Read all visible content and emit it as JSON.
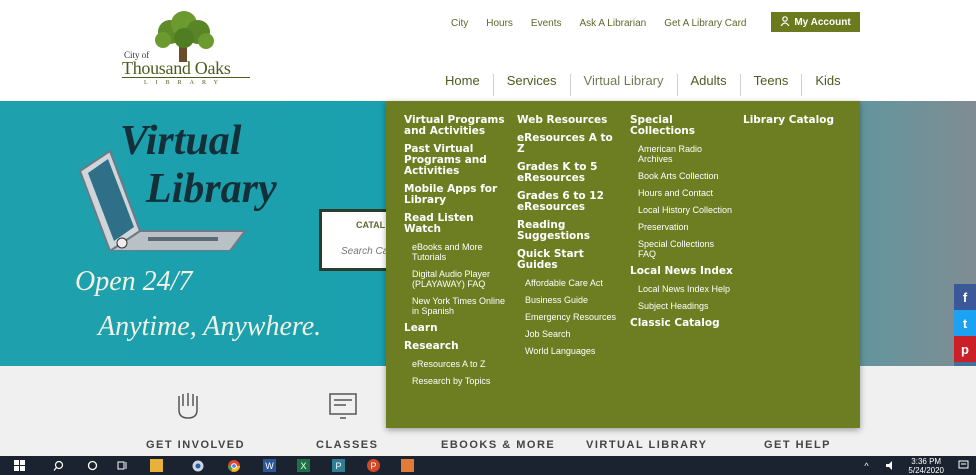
{
  "logo": {
    "city_of": "City of",
    "name": "Thousand Oaks",
    "library": "LIBRARY"
  },
  "utility_nav": [
    "City",
    "Hours",
    "Events",
    "Ask A Librarian",
    "Get A Library Card"
  ],
  "account_button": "My Account",
  "main_nav": [
    "Home",
    "Services",
    "Virtual Library",
    "Adults",
    "Teens",
    "Kids"
  ],
  "hero": {
    "line1": "Virtual",
    "line2": "Library",
    "line3": "Open 24/7",
    "line4": "Anytime, Anywhere.",
    "catalog_label": "CATAL",
    "search_placeholder": "Search Cat"
  },
  "dropdown": {
    "col1": [
      {
        "t": "h",
        "text": "Virtual Programs and Activities"
      },
      {
        "t": "h",
        "text": "Past Virtual Programs and Activities"
      },
      {
        "t": "h",
        "text": "Mobile Apps for Library"
      },
      {
        "t": "h",
        "text": "Read Listen Watch"
      },
      {
        "t": "s",
        "text": "eBooks and More Tutorials"
      },
      {
        "t": "s",
        "text": "Digital Audio Player (PLAYAWAY) FAQ"
      },
      {
        "t": "s",
        "text": "New York Times Online in Spanish"
      },
      {
        "t": "h",
        "text": "Learn"
      },
      {
        "t": "h",
        "text": "Research"
      },
      {
        "t": "s",
        "text": "eResources A to Z"
      },
      {
        "t": "s",
        "text": "Research by Topics"
      }
    ],
    "col2": [
      {
        "t": "h",
        "text": "Web Resources"
      },
      {
        "t": "h",
        "text": "eResources A to Z"
      },
      {
        "t": "h",
        "text": "Grades K to 5 eResources"
      },
      {
        "t": "h",
        "text": "Grades 6 to 12 eResources"
      },
      {
        "t": "h",
        "text": "Reading Suggestions"
      },
      {
        "t": "h",
        "text": "Quick Start Guides"
      },
      {
        "t": "s",
        "text": "Affordable Care Act"
      },
      {
        "t": "s",
        "text": "Business Guide"
      },
      {
        "t": "s",
        "text": "Emergency Resources"
      },
      {
        "t": "s",
        "text": "Job Search"
      },
      {
        "t": "s",
        "text": "World Languages"
      }
    ],
    "col3": [
      {
        "t": "h",
        "text": "Special Collections"
      },
      {
        "t": "s",
        "text": "American Radio Archives"
      },
      {
        "t": "s",
        "text": "Book Arts Collection"
      },
      {
        "t": "s",
        "text": "Hours and Contact"
      },
      {
        "t": "s",
        "text": "Local History Collection"
      },
      {
        "t": "s",
        "text": "Preservation"
      },
      {
        "t": "s",
        "text": "Special Collections FAQ"
      },
      {
        "t": "h",
        "text": "Local News Index"
      },
      {
        "t": "s",
        "text": "Local News Index Help"
      },
      {
        "t": "s",
        "text": "Subject Headings"
      },
      {
        "t": "h",
        "text": "Classic Catalog"
      }
    ],
    "col4": [
      {
        "t": "h",
        "text": "Library Catalog"
      }
    ]
  },
  "quick_links": [
    "GET INVOLVED",
    "CLASSES",
    "EBOOKS & MORE",
    "VIRTUAL LIBRARY",
    "GET HELP"
  ],
  "social": [
    {
      "icon": "facebook-icon",
      "glyph": "f",
      "color": "#3b5998"
    },
    {
      "icon": "twitter-icon",
      "glyph": "t",
      "color": "#1da1f2"
    },
    {
      "icon": "pinterest-icon",
      "glyph": "p",
      "color": "#cb2027"
    },
    {
      "icon": "instagram-icon",
      "glyph": "◎",
      "color": "#3f729b"
    },
    {
      "icon": "youtube-icon",
      "glyph": "▶",
      "color": "#cd201f"
    }
  ],
  "taskbar": {
    "time": "3:36 PM",
    "date": "5/24/2020"
  }
}
